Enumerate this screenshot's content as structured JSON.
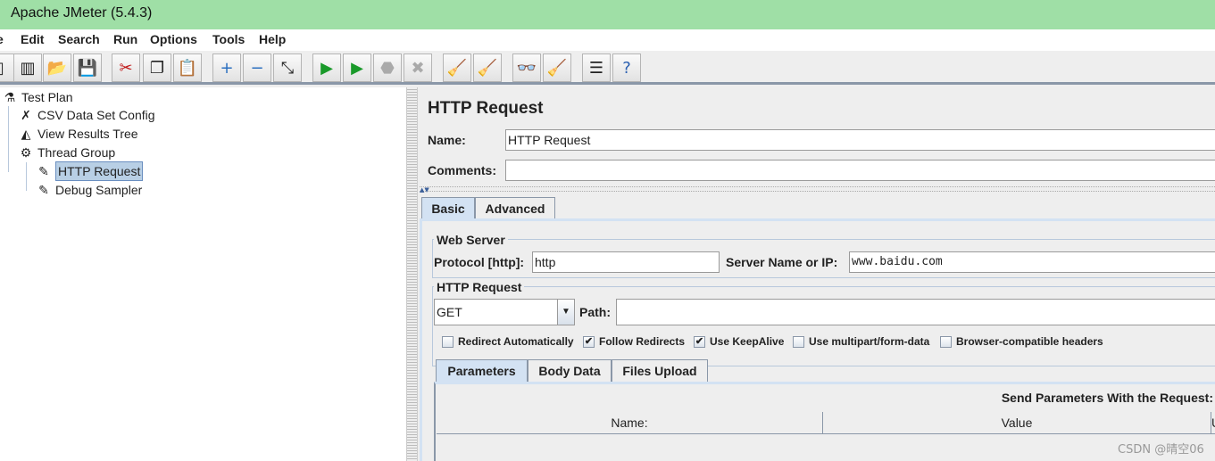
{
  "window": {
    "title": "Apache JMeter (5.4.3)"
  },
  "menu": [
    "e",
    "Edit",
    "Search",
    "Run",
    "Options",
    "Tools",
    "Help"
  ],
  "toolbar": [
    {
      "icon": "new-icon",
      "glyph": "▯"
    },
    {
      "icon": "templates-icon",
      "glyph": "▥"
    },
    {
      "icon": "open-icon",
      "glyph": "📂"
    },
    {
      "icon": "save-icon",
      "glyph": "💾"
    },
    {
      "icon": "cut-icon",
      "glyph": "✂"
    },
    {
      "icon": "copy-icon",
      "glyph": "❐"
    },
    {
      "icon": "paste-icon",
      "glyph": "📋"
    },
    {
      "icon": "expand-icon",
      "glyph": "+"
    },
    {
      "icon": "collapse-icon",
      "glyph": "−"
    },
    {
      "icon": "toggle-icon",
      "glyph": "⤡"
    },
    {
      "icon": "start-icon",
      "glyph": "▶"
    },
    {
      "icon": "start-no-timers-icon",
      "glyph": "▶"
    },
    {
      "icon": "stop-icon",
      "glyph": "⬣",
      "disabled": true
    },
    {
      "icon": "shutdown-icon",
      "glyph": "✖",
      "disabled": true
    },
    {
      "icon": "clear-icon",
      "glyph": "🧹"
    },
    {
      "icon": "clear-all-icon",
      "glyph": "🧹"
    },
    {
      "icon": "search-icon",
      "glyph": "👓"
    },
    {
      "icon": "reset-search-icon",
      "glyph": "🧹"
    },
    {
      "icon": "function-helper-icon",
      "glyph": "☰"
    },
    {
      "icon": "help-icon",
      "glyph": "?"
    }
  ],
  "tree": [
    {
      "label": "Test Plan",
      "icon": "flask-icon",
      "glyph": "⚗"
    },
    {
      "label": "CSV Data Set Config",
      "icon": "tools-icon",
      "glyph": "✗"
    },
    {
      "label": "View Results Tree",
      "icon": "chart-icon",
      "glyph": "◭"
    },
    {
      "label": "Thread Group",
      "icon": "gear-icon",
      "glyph": "⚙"
    },
    {
      "label": "HTTP Request",
      "icon": "pipette-icon",
      "glyph": "✎",
      "selected": true
    },
    {
      "label": "Debug Sampler",
      "icon": "pipette-icon",
      "glyph": "✎"
    }
  ],
  "panel": {
    "title": "HTTP Request",
    "name_label": "Name:",
    "name_value": "HTTP Request",
    "comments_label": "Comments:",
    "comments_value": "",
    "tabs": [
      "Basic",
      "Advanced"
    ],
    "web_server": {
      "legend": "Web Server",
      "protocol_label": "Protocol [http]:",
      "protocol_value": "http",
      "server_label": "Server Name or IP:",
      "server_value": "www.baidu.com"
    },
    "http_request": {
      "legend": "HTTP Request",
      "method": "GET",
      "path_label": "Path:",
      "path_value": ""
    },
    "checkboxes": [
      {
        "label": "Redirect Automatically",
        "checked": false
      },
      {
        "label": "Follow Redirects",
        "checked": true
      },
      {
        "label": "Use KeepAlive",
        "checked": true
      },
      {
        "label": "Use multipart/form-data",
        "checked": false
      },
      {
        "label": "Browser-compatible headers",
        "checked": false
      }
    ],
    "subtabs": [
      "Parameters",
      "Body Data",
      "Files Upload"
    ],
    "params_heading": "Send Parameters With the Request:",
    "columns": [
      "Name:",
      "Value",
      "U"
    ]
  },
  "watermark": "CSDN @晴空06"
}
